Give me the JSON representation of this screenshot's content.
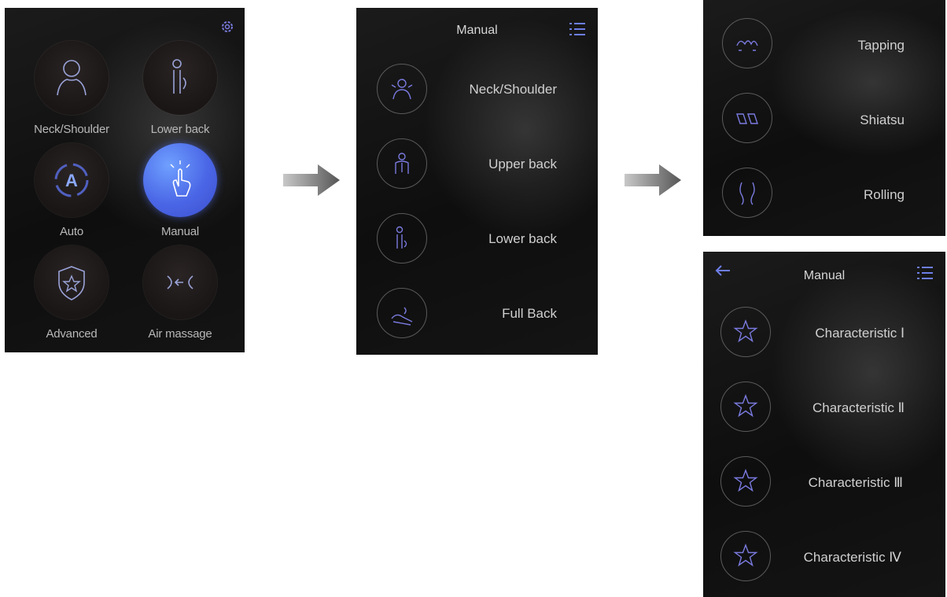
{
  "home_screen": {
    "items": [
      {
        "label": "Neck/Shoulder",
        "icon": "head-shoulder-icon"
      },
      {
        "label": "Lower back",
        "icon": "lower-back-icon"
      },
      {
        "label": "Auto",
        "icon": "auto-icon",
        "badge": "A"
      },
      {
        "label": "Manual",
        "icon": "hand-touch-icon",
        "selected": true
      },
      {
        "label": "Advanced",
        "icon": "shield-star-icon"
      },
      {
        "label": "Air massage",
        "icon": "air-massage-icon"
      }
    ],
    "settings_icon": "gear-icon"
  },
  "manual_screen": {
    "title": "Manual",
    "items": [
      {
        "label": "Neck/Shoulder",
        "icon": "neck-shoulder-icon"
      },
      {
        "label": "Upper back",
        "icon": "upper-back-icon"
      },
      {
        "label": "Lower back",
        "icon": "lower-back-icon"
      },
      {
        "label": "Full Back",
        "icon": "full-back-icon"
      }
    ]
  },
  "techniques_screen": {
    "items": [
      {
        "label": "Tapping",
        "icon": "tapping-icon"
      },
      {
        "label": "Shiatsu",
        "icon": "shiatsu-icon"
      },
      {
        "label": "Rolling",
        "icon": "rolling-icon"
      }
    ]
  },
  "characteristics_screen": {
    "title": "Manual",
    "items": [
      {
        "label": "Characteristic Ⅰ",
        "icon": "star-icon"
      },
      {
        "label": "Characteristic Ⅱ",
        "icon": "star-icon"
      },
      {
        "label": "Characteristic Ⅲ",
        "icon": "star-icon"
      },
      {
        "label": "Characteristic Ⅳ",
        "icon": "star-icon"
      }
    ]
  },
  "colors": {
    "accent_blue": "#4a66e6",
    "icon_purple": "#7a7ae0",
    "text": "#d0d0d0",
    "background": "#111111"
  }
}
